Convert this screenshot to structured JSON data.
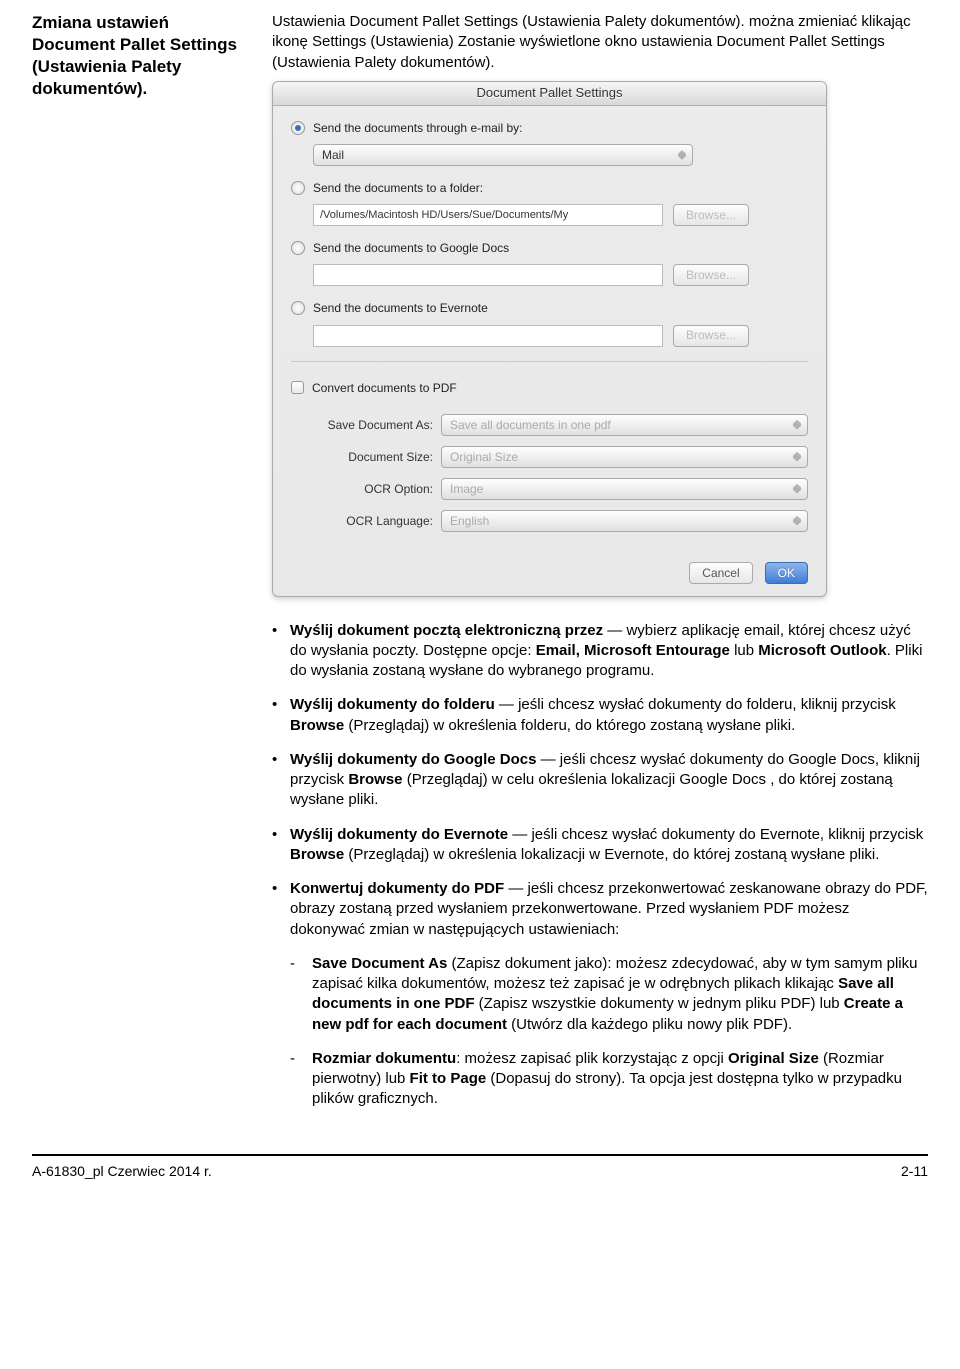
{
  "leftHeading": "Zmiana ustawień Document Pallet Settings (Ustawienia Palety dokumentów).",
  "intro": {
    "part1": "Ustawienia Document Pallet Settings (Ustawienia Palety dokumentów). można zmieniać klikając ikonę Settings (Ustawienia) Zostanie wyświetlone okno ustawienia Document Pallet Settings (Ustawienia Palety dokumentów)."
  },
  "dialog": {
    "title": "Document Pallet Settings",
    "sendEmailLabel": "Send the documents through e-mail by:",
    "mailOption": "Mail",
    "sendFolderLabel": "Send the documents to a folder:",
    "folderPath": "/Volumes/Macintosh HD/Users/Sue/Documents/My",
    "browse": "Browse...",
    "sendGoogleLabel": "Send the documents to Google Docs",
    "sendEvernoteLabel": "Send the documents to Evernote",
    "convertPdfLabel": "Convert documents to PDF",
    "saveDocAsLabel": "Save Document As:",
    "saveDocAsValue": "Save all documents in one pdf",
    "docSizeLabel": "Document Size:",
    "docSizeValue": "Original Size",
    "ocrOptionLabel": "OCR Option:",
    "ocrOptionValue": "Image",
    "ocrLangLabel": "OCR Language:",
    "ocrLangValue": "English",
    "cancel": "Cancel",
    "ok": "OK"
  },
  "bullets": {
    "b1_strong": "Wyślij dokument pocztą elektroniczną przez",
    "b1_rest": " — wybierz aplikację email, której chcesz użyć do wysłania poczty. Dostępne opcje: ",
    "b1_strong2": "Email, Microsoft Entourage",
    "b1_mid": " lub ",
    "b1_strong3": "Microsoft Outlook",
    "b1_end": ". Pliki do wysłania zostaną wysłane do wybranego programu.",
    "b2_strong": "Wyślij dokumenty do folderu",
    "b2_rest": " — jeśli chcesz wysłać dokumenty do folderu, kliknij przycisk ",
    "b2_strong2": "Browse",
    "b2_end": " (Przeglądaj) w określenia folderu, do którego zostaną wysłane pliki.",
    "b3_strong": "Wyślij dokumenty do Google Docs",
    "b3_rest": " — jeśli chcesz wysłać dokumenty do Google Docs, kliknij przycisk ",
    "b3_strong2": "Browse",
    "b3_end": " (Przeglądaj) w celu określenia lokalizacji Google Docs , do której zostaną wysłane pliki.",
    "b4_strong": "Wyślij dokumenty do Evernote",
    "b4_rest": " — jeśli chcesz wysłać dokumenty do Evernote, kliknij przycisk ",
    "b4_strong2": "Browse",
    "b4_end": " (Przeglądaj) w określenia lokalizacji w Evernote, do której zostaną wysłane pliki.",
    "b5_strong": "Konwertuj dokumenty do PDF",
    "b5_rest": " — jeśli chcesz przekonwertować zeskanowane obrazy do PDF, obrazy zostaną przed wysłaniem przekonwertowane. Przed wysłaniem PDF możesz dokonywać zmian w następujących ustawieniach:",
    "s1_strong": "Save Document As",
    "s1_rest": " (Zapisz dokument jako): możesz zdecydować, aby w tym samym pliku zapisać kilka dokumentów, możesz też zapisać je w odrębnych plikach klikając ",
    "s1_strong2": "Save all documents in one PDF",
    "s1_mid": " (Zapisz wszystkie dokumenty w jednym pliku PDF) lub ",
    "s1_strong3": "Create a new pdf for each document",
    "s1_end": " (Utwórz dla każdego pliku nowy plik PDF).",
    "s2_strong": "Rozmiar dokumentu",
    "s2_rest": ": możesz zapisać plik korzystając z opcji ",
    "s2_strong2": "Original Size",
    "s2_mid": " (Rozmiar pierwotny) lub ",
    "s2_strong3": "Fit to Page",
    "s2_end": " (Dopasuj do strony). Ta opcja jest dostępna tylko w przypadku plików graficznych."
  },
  "footer": {
    "left": "A-61830_pl  Czerwiec 2014 r.",
    "right": "2-11"
  }
}
